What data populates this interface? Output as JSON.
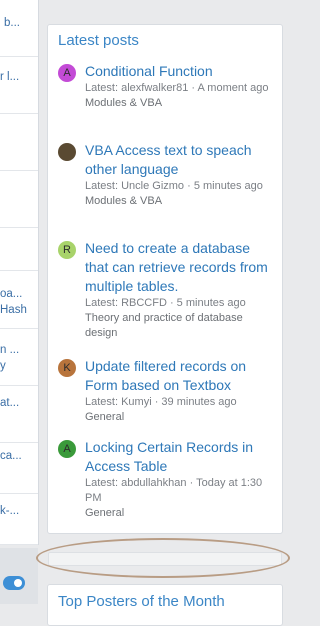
{
  "left_column": {
    "fragments": [
      "b...",
      "r l...",
      "oa...",
      "Hash",
      "n ...",
      "y",
      "at...",
      "ca...",
      "k-..."
    ]
  },
  "latest_posts": {
    "title": "Latest posts",
    "posts": [
      {
        "avatar": "A",
        "avatar_color": "#c34bd6",
        "title": "Conditional Function",
        "meta": "Latest: alexfwalker81 · A moment ago",
        "forum": "Modules & VBA"
      },
      {
        "avatar": "",
        "avatar_color": "#5a4a32",
        "title": "VBA Access text to speach other language",
        "meta": "Latest: Uncle Gizmo · 5 minutes ago",
        "forum": "Modules & VBA"
      },
      {
        "avatar": "R",
        "avatar_color": "#a8d36a",
        "title": "Need to create a database that can retrieve records from multiple tables.",
        "meta": "Latest: RBCCFD · 5 minutes ago",
        "forum": "Theory and practice of database design"
      },
      {
        "avatar": "K",
        "avatar_color": "#b8743c",
        "title": "Update filtered records on Form based on Textbox",
        "meta": "Latest: Kumyi · 39 minutes ago",
        "forum": "General"
      },
      {
        "avatar": "A",
        "avatar_color": "#3a9a3a",
        "title": "Locking Certain Records in Access Table",
        "meta": "Latest: abdullahkhan · Today at 1:30 PM",
        "forum": "General"
      }
    ]
  },
  "top_posters": {
    "title": "Top Posters of the Month"
  }
}
